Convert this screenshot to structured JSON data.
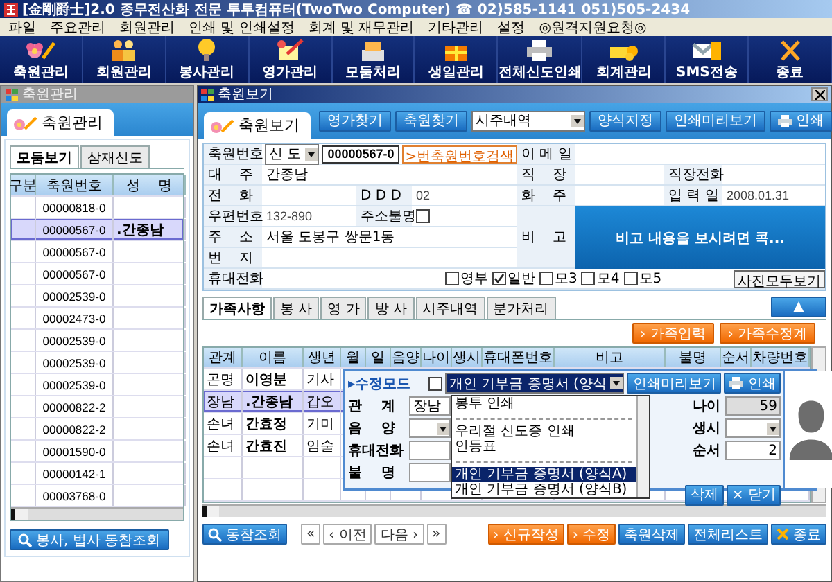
{
  "app_title": "[金剛爵士]2.0 종무전산화 전문 투투컴퓨터(TwoTwo Computer) ☎ 02)585-1141  051)505-2434",
  "menu": [
    "파일",
    "주요관리",
    "회원관리",
    "인쇄 및 인쇄설정",
    "회계 및 재무관리",
    "기타관리",
    "설정",
    "◎원격지원요청◎"
  ],
  "toolbar": [
    "축원관리",
    "회원관리",
    "봉사관리",
    "영가관리",
    "모둠처리",
    "생일관리",
    "전체신도인쇄",
    "회계관리",
    "SMS전송",
    "종료"
  ],
  "left_window": {
    "title": "축원관리",
    "tab_label": "축원관리",
    "tabs": [
      {
        "label": "모둠보기",
        "selected": true
      },
      {
        "label": "삼재신도",
        "selected": false
      }
    ],
    "columns": [
      "구분",
      "축원번호",
      "성    명"
    ],
    "rows": [
      {
        "number": "00000818-0",
        "selected": false
      },
      {
        "number": "00000567-0",
        "name": ".간종남",
        "selected": true
      },
      {
        "number": "00000567-0",
        "selected": false
      },
      {
        "number": "00000567-0",
        "selected": false
      },
      {
        "number": "00002539-0",
        "selected": false
      },
      {
        "number": "00002473-0",
        "selected": false
      },
      {
        "number": "00002539-0",
        "selected": false
      },
      {
        "number": "00002539-0",
        "selected": false
      },
      {
        "number": "00002539-0",
        "selected": false
      },
      {
        "number": "00000822-2",
        "selected": false
      },
      {
        "number": "00000822-2",
        "selected": false
      },
      {
        "number": "00001590-0",
        "selected": false
      },
      {
        "number": "00000142-1",
        "selected": false
      },
      {
        "number": "00003768-0",
        "selected": false
      }
    ],
    "lookup_button": "봉사, 법사 동참조회"
  },
  "main_window": {
    "title": "축원보기",
    "tab_label": "축원보기",
    "toolbar_buttons": [
      "영가찾기",
      "축원찾기"
    ],
    "report_select": "시주내역",
    "form_button": "양식지정",
    "preview_button": "인쇄미리보기",
    "print_button": "인쇄",
    "form": {
      "member_no": {
        "label": "축원번호",
        "type": "신 도",
        "value": "00000567-0",
        "search_button": ">번축원번호검색"
      },
      "email_label": "이 메 일",
      "head": {
        "label": "대    주",
        "value": "간종남"
      },
      "workplace_label": "직    장",
      "work_phone_label": "직장전화",
      "phone_label": "전    화",
      "ddd_label": "D D D",
      "ddd_value": "02",
      "host_label": "화    주",
      "entry_date": {
        "label": "입 력 일",
        "value": "2008.01.31"
      },
      "postcode": {
        "label": "우편번호",
        "value": "132-890"
      },
      "address_unknown": {
        "label": "주소불명",
        "checked": false
      },
      "note": {
        "label": "비    고",
        "text": "비고 내용을 보시려면 콕..."
      },
      "address": {
        "label": "주    소",
        "value": "서울 도봉구 쌍문1동"
      },
      "lot_label": "번    지",
      "mobile_label": "휴대전화",
      "categories": [
        {
          "label": "영부",
          "checked": false
        },
        {
          "label": "일반",
          "checked": true
        },
        {
          "label": "모3",
          "checked": false
        },
        {
          "label": "모4",
          "checked": false
        },
        {
          "label": "모5",
          "checked": false
        }
      ],
      "photo_button": "사진모두보기"
    },
    "family_tabs": [
      {
        "label": "가족사항",
        "selected": true
      },
      {
        "label": "봉  사",
        "selected": false
      },
      {
        "label": "영  가",
        "selected": false
      },
      {
        "label": "방  사",
        "selected": false
      },
      {
        "label": "시주내역",
        "selected": false
      },
      {
        "label": "분가처리",
        "selected": false
      }
    ],
    "collapse_button": "▲",
    "family_buttons": [
      "› 가족입력",
      "› 가족수정계"
    ],
    "family_columns": [
      "관계",
      "이름",
      "생년",
      "월",
      "일",
      "음양",
      "나이",
      "생시",
      "휴대폰번호",
      "비고",
      "불명",
      "순서",
      "차량번호"
    ],
    "family_rows": [
      {
        "relation": "곤명",
        "name": "이영분",
        "year": "기사",
        "selected": false
      },
      {
        "relation": "장남",
        "name": ".간종남",
        "year": "갑오",
        "selected": true
      },
      {
        "relation": "손녀",
        "name": "간효정",
        "year": "기미",
        "selected": false
      },
      {
        "relation": "손녀",
        "name": "간효진",
        "year": "임술",
        "selected": false
      }
    ],
    "edit_popup": {
      "mode_label": "▸수정모드",
      "edit_mode": false,
      "document_select": "개인 기부금 증명서 (양식",
      "preview_button": "인쇄미리보기",
      "print_button": "인쇄",
      "options": [
        {
          "kind": "item",
          "label": "봉투 인쇄",
          "selected": false
        },
        {
          "kind": "separator"
        },
        {
          "kind": "item",
          "label": "우리절 신도증 인쇄",
          "selected": false
        },
        {
          "kind": "item",
          "label": "인등표",
          "selected": false
        },
        {
          "kind": "separator"
        },
        {
          "kind": "item",
          "label": "개인 기부금 증명서 (양식A)",
          "selected": true
        },
        {
          "kind": "item",
          "label": "개인 기부금 증명서 (양식B)",
          "selected": false
        }
      ],
      "relation": {
        "label": "관    계",
        "value": "장남"
      },
      "yinyang_label": "음    양",
      "mobile_label": "휴대전화",
      "unknown_label": "불    명",
      "age": {
        "label": "나이",
        "value": "59"
      },
      "birth_hour_label": "생시",
      "order": {
        "label": "순서",
        "value": "2"
      },
      "delete_button": "삭제",
      "close_button": "× 닫기"
    },
    "bottom_buttons": [
      {
        "label": "동참조회",
        "kind": "search"
      },
      {
        "label": "«",
        "kind": "nav"
      },
      {
        "label": "‹ 이전",
        "kind": "nav"
      },
      {
        "label": "다음 ›",
        "kind": "nav"
      },
      {
        "label": "»",
        "kind": "nav"
      },
      {
        "label": "› 신규작성",
        "kind": "orange"
      },
      {
        "label": "› 수정",
        "kind": "orange"
      },
      {
        "label": "축원삭제",
        "kind": "blue"
      },
      {
        "label": "전체리스트",
        "kind": "blue"
      },
      {
        "label": "종료",
        "kind": "exit"
      }
    ]
  }
}
